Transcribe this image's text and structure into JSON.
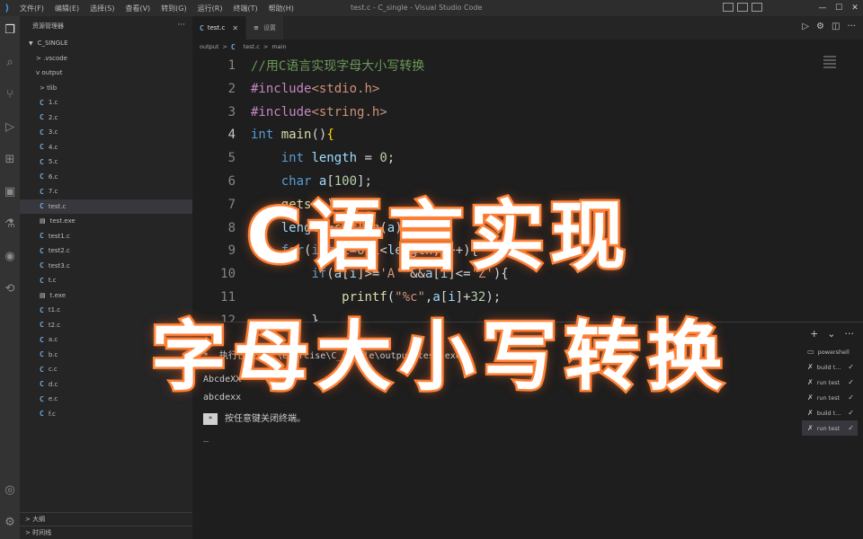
{
  "titlebar": {
    "menu": [
      "文件(F)",
      "编辑(E)",
      "选择(S)",
      "查看(V)",
      "转到(G)",
      "运行(R)",
      "终端(T)",
      "帮助(H)"
    ],
    "title": "test.c - C_single - Visual Studio Code"
  },
  "activitybar": {
    "icons": [
      "explorer-icon",
      "search-icon",
      "source-control-icon",
      "run-debug-icon",
      "extensions-icon",
      "remote-icon",
      "testing-icon",
      "github-icon",
      "share-icon",
      "account-icon",
      "settings-gear-icon"
    ]
  },
  "sidebar": {
    "title": "资源管理器",
    "root": "C_SINGLE",
    "items": [
      {
        "label": "> .vscode",
        "kind": "folder"
      },
      {
        "label": "v output",
        "kind": "folder-open"
      },
      {
        "label": "> tlib",
        "kind": "folder"
      },
      {
        "label": "1.c",
        "kind": "c"
      },
      {
        "label": "2.c",
        "kind": "c"
      },
      {
        "label": "3.c",
        "kind": "c"
      },
      {
        "label": "4.c",
        "kind": "c"
      },
      {
        "label": "5.c",
        "kind": "c"
      },
      {
        "label": "6.c",
        "kind": "c"
      },
      {
        "label": "7.c",
        "kind": "c"
      },
      {
        "label": "test.c",
        "kind": "c",
        "selected": true
      },
      {
        "label": "test.exe",
        "kind": "exe"
      },
      {
        "label": "test1.c",
        "kind": "c"
      },
      {
        "label": "test2.c",
        "kind": "c"
      },
      {
        "label": "test3.c",
        "kind": "c"
      },
      {
        "label": "t.c",
        "kind": "c"
      },
      {
        "label": "t.exe",
        "kind": "exe"
      },
      {
        "label": "t1.c",
        "kind": "c"
      },
      {
        "label": "t2.c",
        "kind": "c"
      },
      {
        "label": "a.c",
        "kind": "c"
      },
      {
        "label": "b.c",
        "kind": "c"
      },
      {
        "label": "c.c",
        "kind": "c"
      },
      {
        "label": "d.c",
        "kind": "c"
      },
      {
        "label": "e.c",
        "kind": "c"
      },
      {
        "label": "f.c",
        "kind": "c"
      }
    ],
    "outline": "> 大纲",
    "timeline": "> 时间线"
  },
  "tabs": [
    {
      "label": "test.c",
      "active": true
    },
    {
      "label": "设置",
      "active": false
    }
  ],
  "breadcrumb": [
    "output",
    ">",
    "test.c",
    ">",
    "main"
  ],
  "code": [
    {
      "n": "1",
      "tokens": [
        [
          "comment",
          "//用C语言实现字母大小写转换"
        ]
      ]
    },
    {
      "n": "2",
      "tokens": [
        [
          "pre",
          "#include"
        ],
        [
          "str",
          "<stdio.h>"
        ]
      ]
    },
    {
      "n": "3",
      "tokens": [
        [
          "pre",
          "#include"
        ],
        [
          "str",
          "<string.h>"
        ]
      ]
    },
    {
      "n": "4",
      "tokens": [
        [
          "kw",
          "int"
        ],
        [
          "plain",
          " "
        ],
        [
          "fn",
          "main"
        ],
        [
          "plain",
          "()"
        ],
        [
          "brace",
          "{"
        ]
      ]
    },
    {
      "n": "5",
      "tokens": [
        [
          "plain",
          "    "
        ],
        [
          "kw",
          "int"
        ],
        [
          "plain",
          " "
        ],
        [
          "var",
          "length"
        ],
        [
          "plain",
          " = "
        ],
        [
          "num",
          "0"
        ],
        [
          "plain",
          ";"
        ]
      ]
    },
    {
      "n": "6",
      "tokens": [
        [
          "plain",
          "    "
        ],
        [
          "kw",
          "char"
        ],
        [
          "plain",
          " "
        ],
        [
          "var",
          "a"
        ],
        [
          "plain",
          "["
        ],
        [
          "num",
          "100"
        ],
        [
          "plain",
          "];"
        ]
      ]
    },
    {
      "n": "7",
      "tokens": [
        [
          "plain",
          "    "
        ],
        [
          "fn",
          "gets"
        ],
        [
          "plain",
          "("
        ],
        [
          "var",
          "a"
        ],
        [
          "plain",
          ");"
        ]
      ]
    },
    {
      "n": "8",
      "tokens": [
        [
          "plain",
          "    "
        ],
        [
          "var",
          "length"
        ],
        [
          "plain",
          "="
        ],
        [
          "fn",
          "strlen"
        ],
        [
          "plain",
          "("
        ],
        [
          "var",
          "a"
        ],
        [
          "plain",
          ");"
        ]
      ]
    },
    {
      "n": "9",
      "tokens": [
        [
          "plain",
          "    "
        ],
        [
          "kw",
          "for"
        ],
        [
          "plain",
          "("
        ],
        [
          "kw",
          "int"
        ],
        [
          "plain",
          " "
        ],
        [
          "var",
          "i"
        ],
        [
          "plain",
          "="
        ],
        [
          "num",
          "0"
        ],
        [
          "plain",
          ";"
        ],
        [
          "var",
          "i"
        ],
        [
          "plain",
          "<"
        ],
        [
          "var",
          "length"
        ],
        [
          "plain",
          ";"
        ],
        [
          "var",
          "i"
        ],
        [
          "plain",
          "++){"
        ]
      ]
    },
    {
      "n": "10",
      "tokens": [
        [
          "plain",
          "        "
        ],
        [
          "kw",
          "if"
        ],
        [
          "plain",
          "("
        ],
        [
          "var",
          "a"
        ],
        [
          "plain",
          "["
        ],
        [
          "var",
          "i"
        ],
        [
          "plain",
          "]>="
        ],
        [
          "str",
          "'A'"
        ],
        [
          "plain",
          " &&"
        ],
        [
          "var",
          "a"
        ],
        [
          "plain",
          "["
        ],
        [
          "var",
          "i"
        ],
        [
          "plain",
          "]<="
        ],
        [
          "str",
          "'Z'"
        ],
        [
          "plain",
          "){"
        ]
      ]
    },
    {
      "n": "11",
      "tokens": [
        [
          "plain",
          "            "
        ],
        [
          "fn",
          "printf"
        ],
        [
          "plain",
          "("
        ],
        [
          "str",
          "\"%c\""
        ],
        [
          "plain",
          ","
        ],
        [
          "var",
          "a"
        ],
        [
          "plain",
          "["
        ],
        [
          "var",
          "i"
        ],
        [
          "plain",
          "]+"
        ],
        [
          "num",
          "32"
        ],
        [
          "plain",
          ");"
        ]
      ]
    },
    {
      "n": "12",
      "tokens": [
        [
          "plain",
          "        }"
        ]
      ]
    }
  ],
  "terminal": {
    "task_line": "*  执行任务: C:\\exercise\\C_single\\output\\test.exe",
    "input_line": "AbcdeXX",
    "output_line": "abcdexx",
    "prompt_box": "*",
    "prompt_text": "按任意键关闭终端。",
    "cursor": "_",
    "sessions": [
      {
        "label": "powershell",
        "icon": "terminal-icon"
      },
      {
        "label": "build t...",
        "icon": "tools-icon"
      },
      {
        "label": "run test",
        "icon": "tools-icon"
      },
      {
        "label": "run test",
        "icon": "tools-icon"
      },
      {
        "label": "build t...",
        "icon": "tools-icon"
      },
      {
        "label": "run test",
        "icon": "tools-icon",
        "active": true
      }
    ]
  },
  "overlay": {
    "line1": "C语言实现",
    "line2": "字母大小写转换"
  }
}
